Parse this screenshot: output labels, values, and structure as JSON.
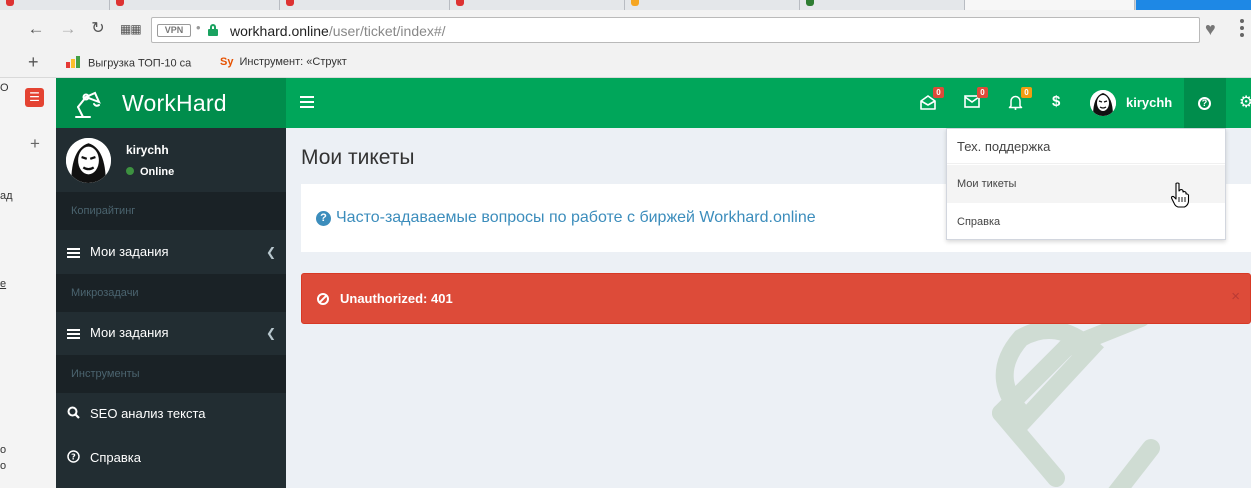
{
  "browser": {
    "url_host": "workhard.online",
    "url_path": "/user/ticket/index#/",
    "vpn_label": "VPN",
    "bookmarks": [
      {
        "label": "Выгрузка ТОП-10 са"
      },
      {
        "label": "Инструмент: «Структ"
      }
    ]
  },
  "app": {
    "brand": "WorkHard",
    "colors": {
      "primary": "#00a65a",
      "primary_dark": "#008d4c",
      "sidebar": "#222d32",
      "danger": "#dd4b39",
      "link": "#3c8dbc"
    }
  },
  "topbar": {
    "icons": [
      {
        "name": "envelope-open-icon",
        "badge": "0",
        "badge_color": "red"
      },
      {
        "name": "envelope-icon",
        "badge": "0",
        "badge_color": "red"
      },
      {
        "name": "bell-icon",
        "badge": "0",
        "badge_color": "orange"
      }
    ],
    "dollar": "$",
    "username": "kirychh"
  },
  "sidebar": {
    "user": {
      "name": "kirychh",
      "status": "Online"
    },
    "sections": [
      {
        "header": "Копирайтинг",
        "item": "Мои задания"
      },
      {
        "header": "Микрозадачи",
        "item": "Мои задания"
      },
      {
        "header": "Инструменты"
      }
    ],
    "seo_item": "SEO анализ текста",
    "help_item": "Справка"
  },
  "main": {
    "page_title": "Мои тикеты",
    "faq_link": "Часто-задаваемые вопросы по работе с биржей Workhard.online",
    "alert_text": "Unauthorized: 401",
    "alert_close": "×"
  },
  "help_dropdown": {
    "header": "Тех. поддержка",
    "items": [
      "Мои тикеты",
      "Справка"
    ]
  }
}
